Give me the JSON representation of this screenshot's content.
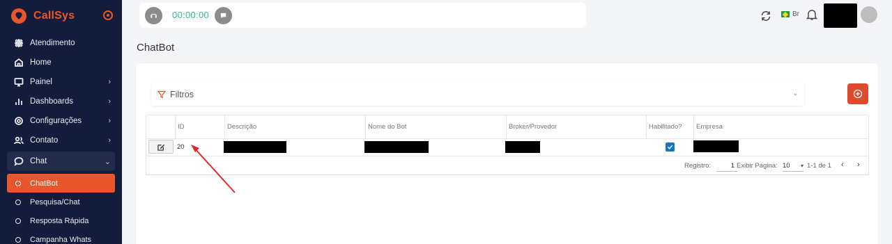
{
  "brand": {
    "name": "CallSys",
    "color": "#e8572c"
  },
  "sidebar": {
    "items": [
      {
        "label": "Atendimento",
        "icon": "grid-icon",
        "has_chevron": false
      },
      {
        "label": "Home",
        "icon": "home-icon",
        "has_chevron": false
      },
      {
        "label": "Painel",
        "icon": "monitor-icon",
        "has_chevron": true
      },
      {
        "label": "Dashboards",
        "icon": "bar-chart-icon",
        "has_chevron": true
      },
      {
        "label": "Configurações",
        "icon": "gear-icon",
        "has_chevron": true
      },
      {
        "label": "Contato",
        "icon": "users-icon",
        "has_chevron": true
      },
      {
        "label": "Chat",
        "icon": "chat-icon",
        "has_chevron": true,
        "open": true
      }
    ],
    "chat_submenu": [
      {
        "label": "ChatBot",
        "active": true
      },
      {
        "label": "Pesquisa/Chat"
      },
      {
        "label": "Resposta Rápida"
      },
      {
        "label": "Campanha Whats"
      }
    ]
  },
  "topbar": {
    "timer": "00:00:00",
    "language": "Br"
  },
  "page": {
    "title": "ChatBot"
  },
  "filter": {
    "label": "Filtros"
  },
  "table": {
    "columns": [
      "ID",
      "Descrição",
      "Nome do Bot",
      "Broker/Provedor",
      "Habilitado?",
      "Empresa"
    ],
    "rows": [
      {
        "id": "20",
        "enabled": true
      }
    ]
  },
  "pagination": {
    "registro_label": "Registro:",
    "registro_value": "1",
    "page_size_label": "Exibir Página:",
    "page_size": "10",
    "range": "1-1 de 1"
  },
  "colors": {
    "accent": "#e8572c",
    "sidebar_bg": "#141c3c",
    "timer": "#2cc185",
    "checkbox": "#1a73c7",
    "add_button": "#de4a2c"
  }
}
